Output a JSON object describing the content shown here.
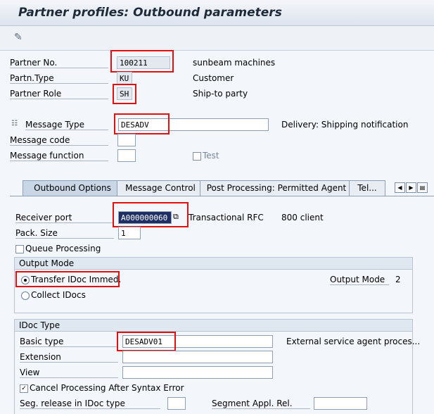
{
  "title": "Partner profiles: Outbound parameters",
  "header": {
    "partner_no": {
      "label": "Partner No.",
      "value": "100211",
      "desc": "sunbeam machines"
    },
    "partn_type": {
      "label": "Partn.Type",
      "value": "KU",
      "desc": "Customer"
    },
    "partner_role": {
      "label": "Partner Role",
      "value": "SH",
      "desc": "Ship-to party"
    },
    "message_type": {
      "label": "Message Type",
      "value": "DESADV",
      "desc": "Delivery: Shipping notification"
    },
    "message_code": {
      "label": "Message code",
      "value": ""
    },
    "message_function": {
      "label": "Message function",
      "value": ""
    },
    "test_label": "Test"
  },
  "tabs": [
    "Outbound Options",
    "Message Control",
    "Post Processing: Permitted Agent",
    "Tel..."
  ],
  "outbound": {
    "receiver_port": {
      "label": "Receiver port",
      "value": "A000000060",
      "type": "Transactional RFC",
      "desc": "800 client"
    },
    "pack_size": {
      "label": "Pack. Size",
      "value": "1"
    },
    "queue_processing": "Queue Processing",
    "output_mode": {
      "heading": "Output Mode",
      "transfer_immed": "Transfer IDoc Immed.",
      "collect": "Collect IDocs",
      "label": "Output Mode",
      "value": "2",
      "selected": "transfer_immed"
    },
    "idoc_type": {
      "heading": "IDoc Type",
      "basic_type_label": "Basic type",
      "basic_type_value": "DESADV01",
      "basic_type_desc": "External service agent proces...",
      "extension_label": "Extension",
      "view_label": "View",
      "cancel_label": "Cancel Processing After Syntax Error",
      "cancel_checked": true,
      "seg_release_label": "Seg. release in IDoc type",
      "segment_appl_label": "Segment Appl. Rel."
    }
  },
  "colors": {
    "highlight": "#e01010",
    "accent": "#c9d6e5"
  }
}
